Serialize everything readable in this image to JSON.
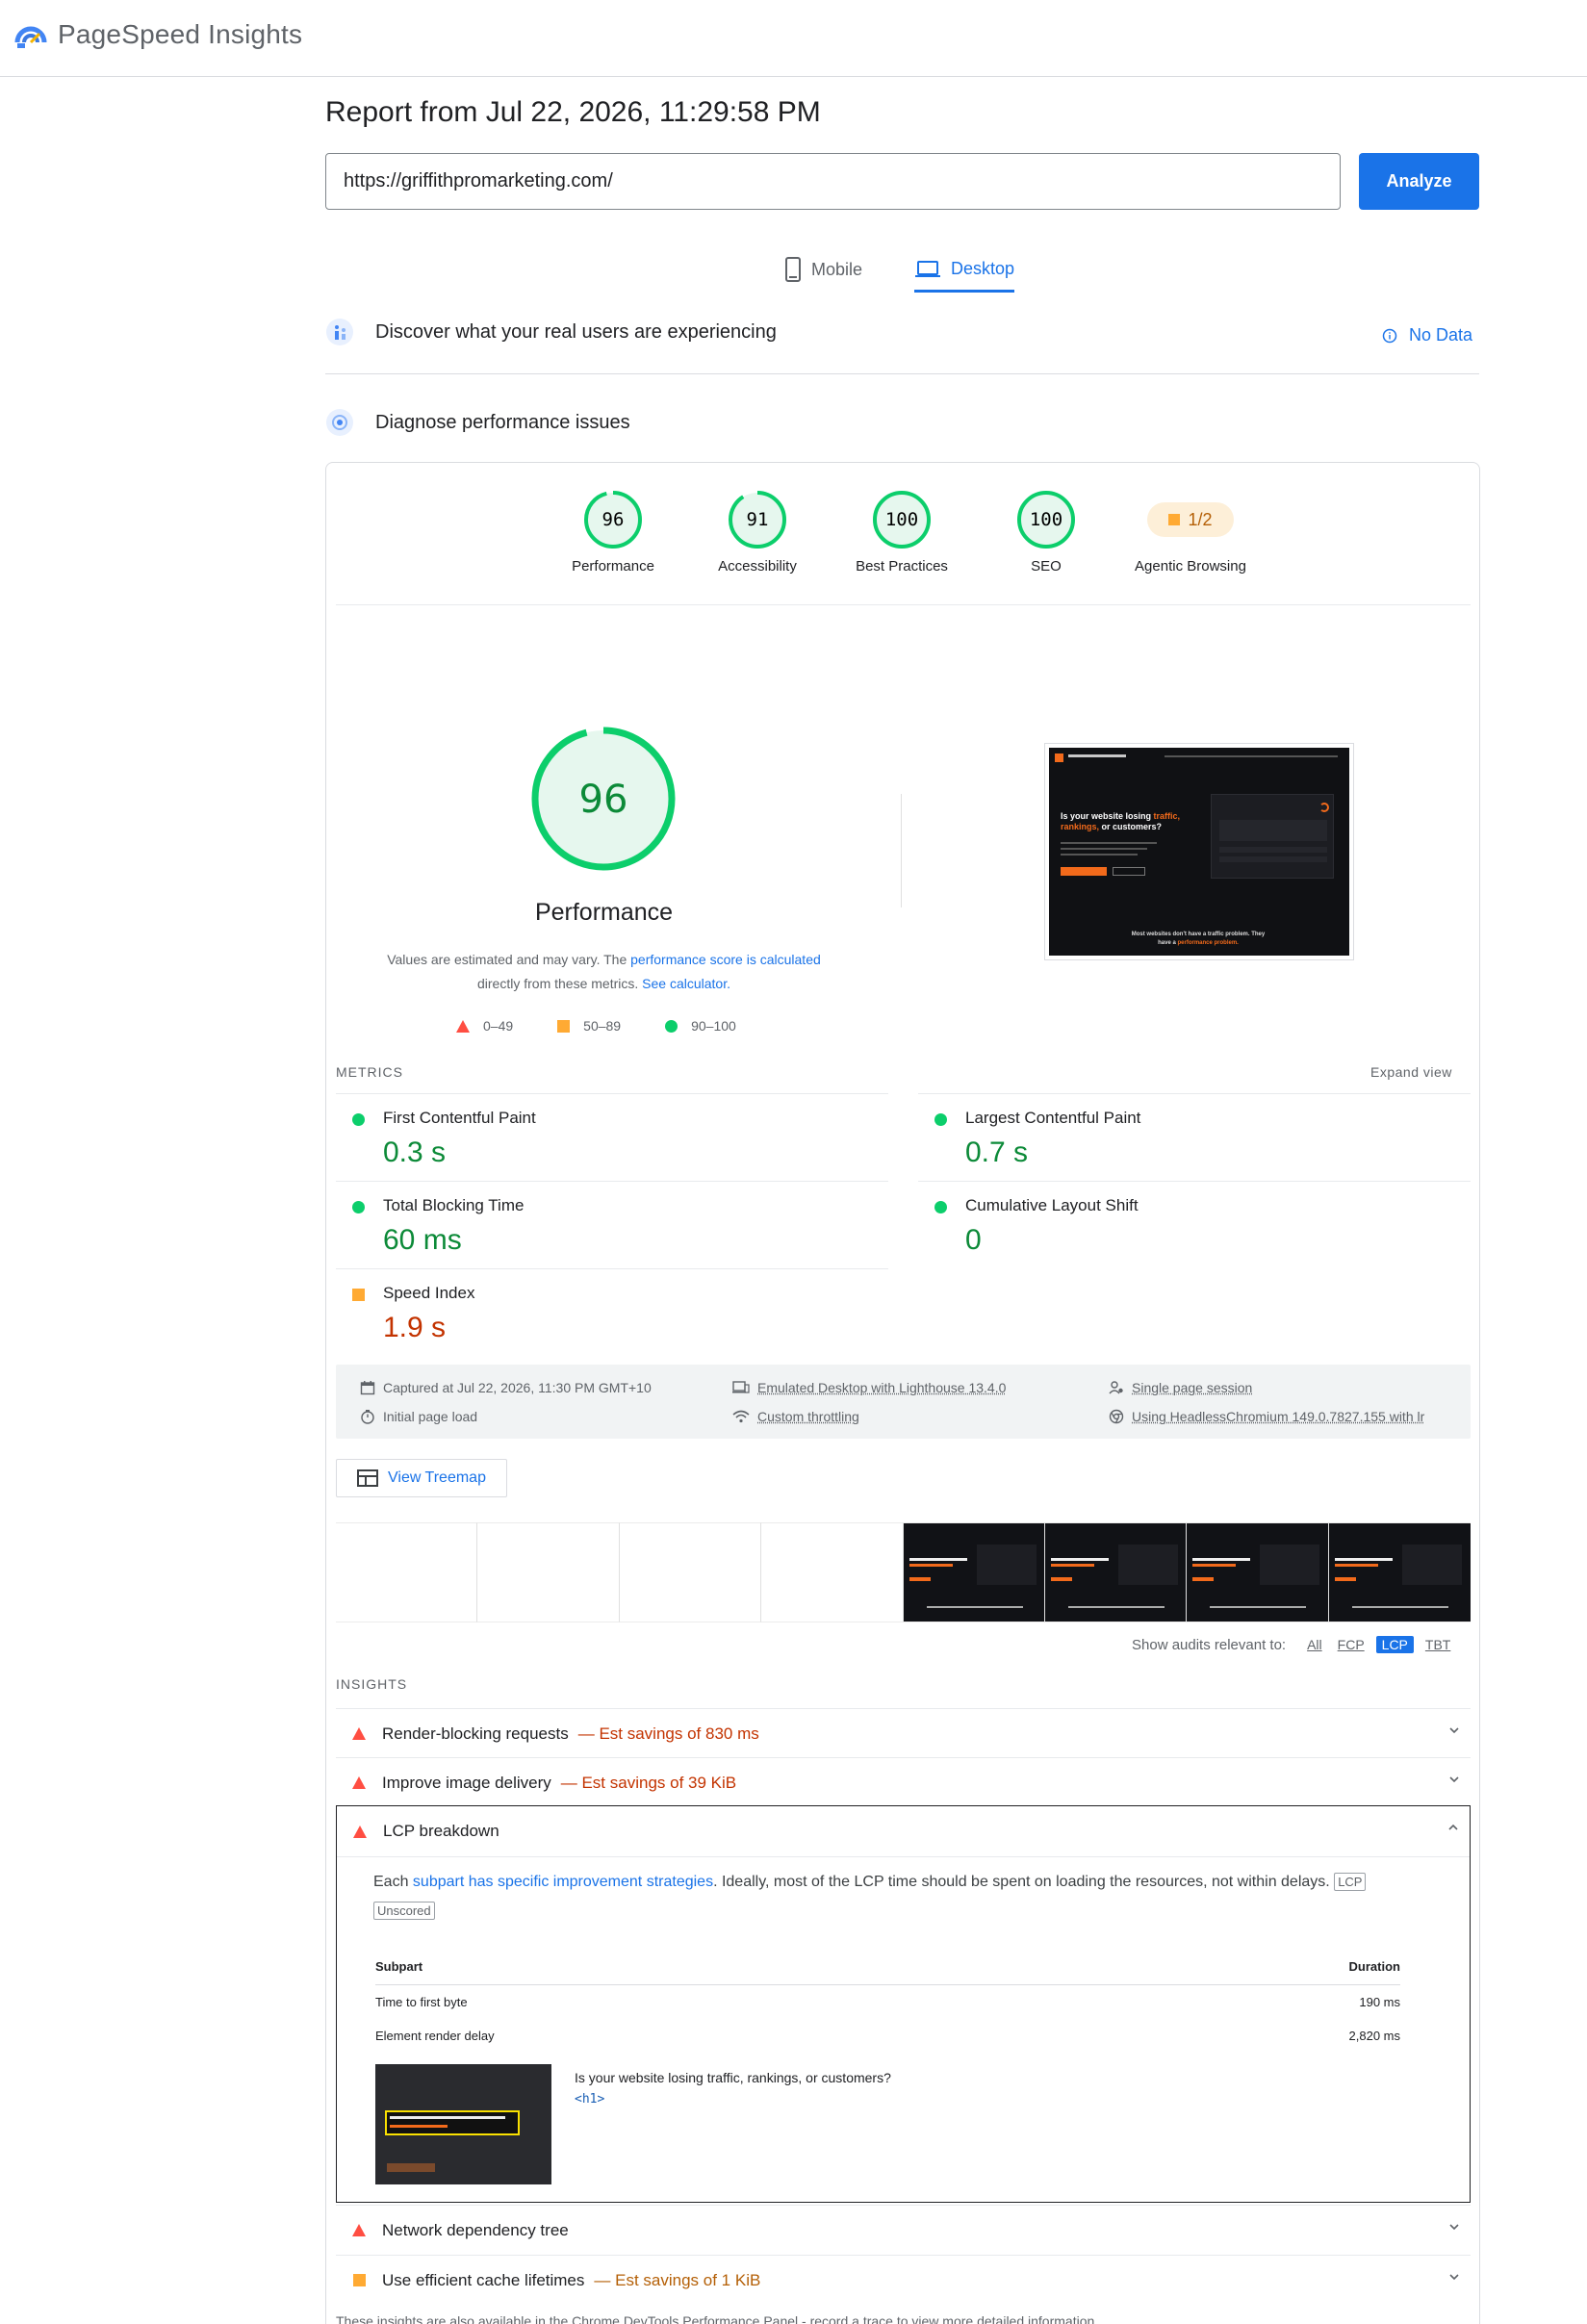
{
  "app": {
    "name": "PageSpeed Insights"
  },
  "report": {
    "title": "Report from Jul 22, 2026, 11:29:58 PM"
  },
  "search": {
    "url": "https://griffithpromarketing.com/",
    "analyze_label": "Analyze"
  },
  "device_tabs": [
    {
      "label": "Mobile",
      "active": false
    },
    {
      "label": "Desktop",
      "active": true
    }
  ],
  "sections": {
    "real_users": "Discover what your real users are experiencing",
    "no_data": "No Data",
    "diagnose": "Diagnose performance issues"
  },
  "scores": [
    {
      "label": "Performance",
      "value": "96",
      "fraction": 0.96
    },
    {
      "label": "Accessibility",
      "value": "91",
      "fraction": 0.91
    },
    {
      "label": "Best Practices",
      "value": "100",
      "fraction": 1.0
    },
    {
      "label": "SEO",
      "value": "100",
      "fraction": 1.0
    },
    {
      "label": "Agentic Browsing",
      "value": "1/2"
    }
  ],
  "perf": {
    "score": "96",
    "title": "Performance",
    "note_1": "Values are estimated and may vary. The ",
    "note_link_1": "performance score is calculated",
    "note_2": "directly from these metrics. ",
    "note_link_2": "See calculator.",
    "legend": [
      "0–49",
      "50–89",
      "90–100"
    ]
  },
  "preview": {
    "headline_1": "Is your website losing ",
    "headline_accent": "traffic, rankings,",
    "headline_2": " or customers?",
    "bottom_1": "Most websites don't have a traffic problem. They",
    "bottom_2": "have a ",
    "bottom_accent": "performance problem."
  },
  "metrics": {
    "label": "METRICS",
    "expand": "Expand view",
    "items": [
      {
        "name": "First Contentful Paint",
        "value": "0.3 s"
      },
      {
        "name": "Largest Contentful Paint",
        "value": "0.7 s"
      },
      {
        "name": "Total Blocking Time",
        "value": "60 ms"
      },
      {
        "name": "Cumulative Layout Shift",
        "value": "0"
      },
      {
        "name": "Speed Index",
        "value": "1.9 s"
      }
    ]
  },
  "captured": {
    "time": "Captured at Jul 22, 2026, 11:30 PM GMT+10",
    "load": "Initial page load",
    "device": "Emulated Desktop with Lighthouse 13.4.0",
    "throttling": "Custom throttling",
    "session": "Single page session",
    "browser": "Using HeadlessChromium 149.0.7827.155 with lr"
  },
  "treemap": {
    "label": "View Treemap"
  },
  "filters": {
    "label": "Show audits relevant to:",
    "options": [
      "All",
      "FCP",
      "LCP",
      "TBT"
    ],
    "active": "LCP"
  },
  "insights": {
    "label": "INSIGHTS",
    "items": [
      {
        "title": "Render-blocking requests",
        "saving": "— Est savings of 830 ms"
      },
      {
        "title": "Improve image delivery",
        "saving": "— Est savings of 39 KiB"
      },
      {
        "title": "LCP breakdown",
        "saving": ""
      },
      {
        "title": "Network dependency tree",
        "saving": ""
      },
      {
        "title": "Use efficient cache lifetimes",
        "saving": "— Est savings of 1 KiB"
      }
    ]
  },
  "lcp": {
    "desc_1": "Each ",
    "desc_link": "subpart has specific improvement strategies",
    "desc_2": ". Ideally, most of the LCP time should be spent on loading the resources, not within delays.",
    "chip_lcp": "LCP",
    "chip_unscored": "Unscored",
    "headers": [
      "Subpart",
      "Duration"
    ],
    "rows": [
      {
        "name": "Time to first byte",
        "duration": "190 ms"
      },
      {
        "name": "Element render delay",
        "duration": "2,820 ms"
      }
    ],
    "element_text": "Is your website losing traffic, rankings, or customers?",
    "element_tag": "<h1>"
  },
  "footer": {
    "note": "These insights are also available in the Chrome DevTools Performance Panel - record a trace to view more detailed information."
  },
  "colors": {
    "pass": "#0cce6b",
    "average": "#ffaa33",
    "fail": "#ff4e42",
    "accent": "#1a73e8",
    "brand_orange": "#f26a1b"
  }
}
